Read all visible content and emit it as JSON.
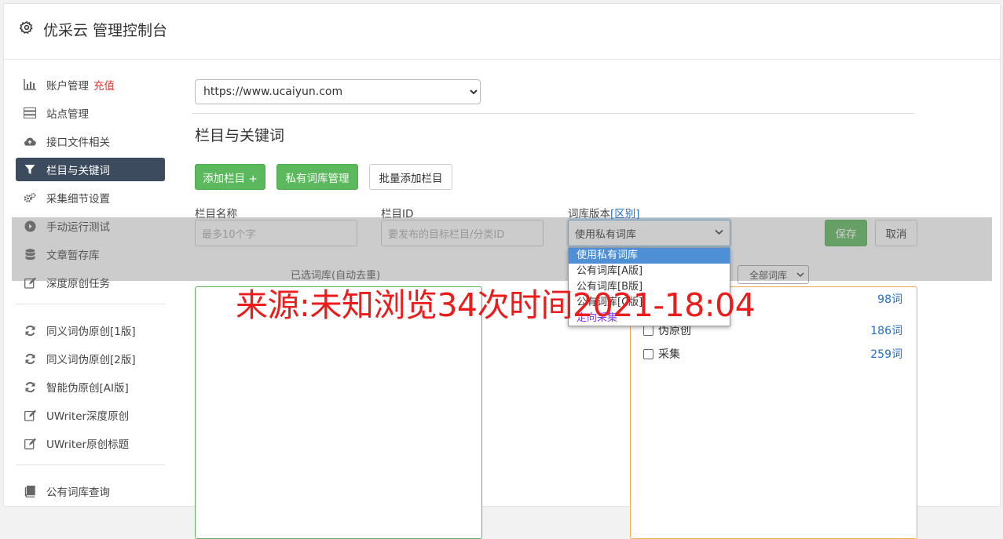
{
  "app": {
    "title": "优采云 管理控制台",
    "icon": "gear-icon"
  },
  "sidebar": {
    "items": [
      {
        "label": "账户管理",
        "extra": "充值",
        "icon": "bar-chart-icon"
      },
      {
        "label": "站点管理",
        "icon": "server-icon"
      },
      {
        "label": "接口文件相关",
        "icon": "cloud-upload-icon"
      },
      {
        "label": "栏目与关键词",
        "icon": "filter-icon",
        "active": true
      },
      {
        "label": "采集细节设置",
        "icon": "cogs-icon"
      },
      {
        "label": "手动运行测试",
        "icon": "play-circle-icon"
      },
      {
        "label": "文章暂存库",
        "icon": "database-icon"
      },
      {
        "label": "深度原创任务",
        "icon": "edit-icon"
      },
      {
        "label": "同义词伪原创[1版]",
        "icon": "refresh-icon"
      },
      {
        "label": "同义词伪原创[2版]",
        "icon": "refresh-icon"
      },
      {
        "label": "智能伪原创[AI版]",
        "icon": "refresh-icon"
      },
      {
        "label": "UWriter深度原创",
        "icon": "edit-icon"
      },
      {
        "label": "UWriter原创标题",
        "icon": "edit-icon"
      },
      {
        "label": "公有词库查询",
        "icon": "book-icon"
      }
    ]
  },
  "main": {
    "site_select": {
      "value": "https://www.ucaiyun.com"
    },
    "section_title": "栏目与关键词",
    "buttons": {
      "add_column": "添加栏目 +",
      "private_lib": "私有词库管理",
      "batch_add": "批量添加栏目"
    },
    "form": {
      "name_label": "栏目名称",
      "name_placeholder": "最多10个字",
      "id_label": "栏目ID",
      "id_placeholder": "要发布的目标栏目/分类ID",
      "version_label": "词库版本",
      "version_link": "[区别]",
      "version_value": "使用私有词库",
      "save": "保存",
      "cancel": "取消"
    },
    "selected_label": "已选词库(自动去重)",
    "all_libs_select": "全部词库",
    "libraries": [
      {
        "name": "",
        "count": "98词"
      },
      {
        "name": "伪原创",
        "count": "186词"
      },
      {
        "name": "采集",
        "count": "259词"
      }
    ],
    "dropdown": {
      "options": [
        "使用私有词库",
        "公有词库[A版]",
        "公有词库[B版]",
        "公有词库[C版]",
        "定向采集"
      ]
    }
  },
  "watermark": "来源:未知浏览34次时间2021-18:04",
  "colors": {
    "accent_green": "#5cb85c",
    "nav_active": "#3d4b5e",
    "link_blue": "#1f6ec9",
    "watermark_red": "#ee1b1b",
    "panel_yellow": "#f0ad4e"
  }
}
